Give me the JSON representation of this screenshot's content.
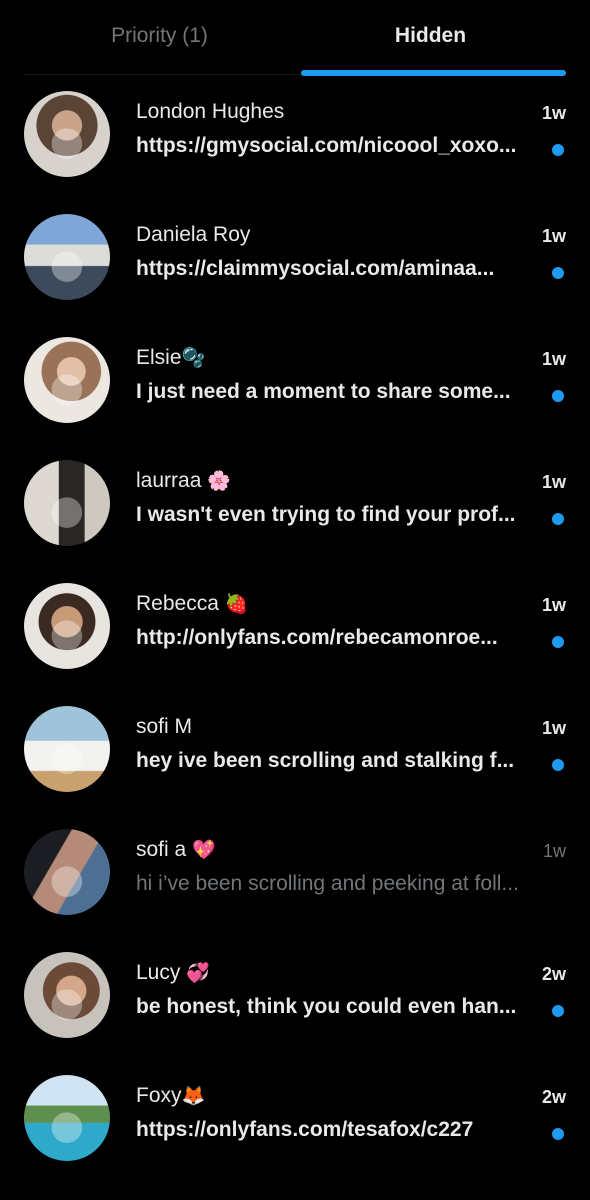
{
  "tabs": [
    {
      "label": "Priority (1)",
      "active": false
    },
    {
      "label": "Hidden",
      "active": true
    }
  ],
  "accent_color": "#1d9bf0",
  "conversations": [
    {
      "name": "London Hughes",
      "emoji": "",
      "time": "1w",
      "message": "https://gmysocial.com/nicoool_xoxo...",
      "unread": true
    },
    {
      "name": "Daniela Roy",
      "emoji": "",
      "time": "1w",
      "message": "https://claimmysocial.com/aminaa...",
      "unread": true
    },
    {
      "name": "Elsie",
      "emoji": "🫧",
      "time": "1w",
      "message": "I just need a moment to share some...",
      "unread": true
    },
    {
      "name": "laurraa",
      "emoji": "🌸",
      "time": "1w",
      "message": "I wasn't even trying to find your prof...",
      "unread": true
    },
    {
      "name": "Rebecca",
      "emoji": "🍓",
      "time": "1w",
      "message": "http://onlyfans.com/rebecamonroe...",
      "unread": true
    },
    {
      "name": "sofi M",
      "emoji": "",
      "time": "1w",
      "message": "hey ive been scrolling and stalking f...",
      "unread": true
    },
    {
      "name": "sofi a",
      "emoji": "💖",
      "time": "1w",
      "message": "hi i’ve been scrolling and peeking at foll...",
      "unread": false
    },
    {
      "name": "Lucy",
      "emoji": "💞",
      "time": "2w",
      "message": "be honest, think you could even han...",
      "unread": true
    },
    {
      "name": "Foxy",
      "emoji": "🦊",
      "time": "2w",
      "message": "https://onlyfans.com/tesafox/c227",
      "unread": true
    }
  ]
}
